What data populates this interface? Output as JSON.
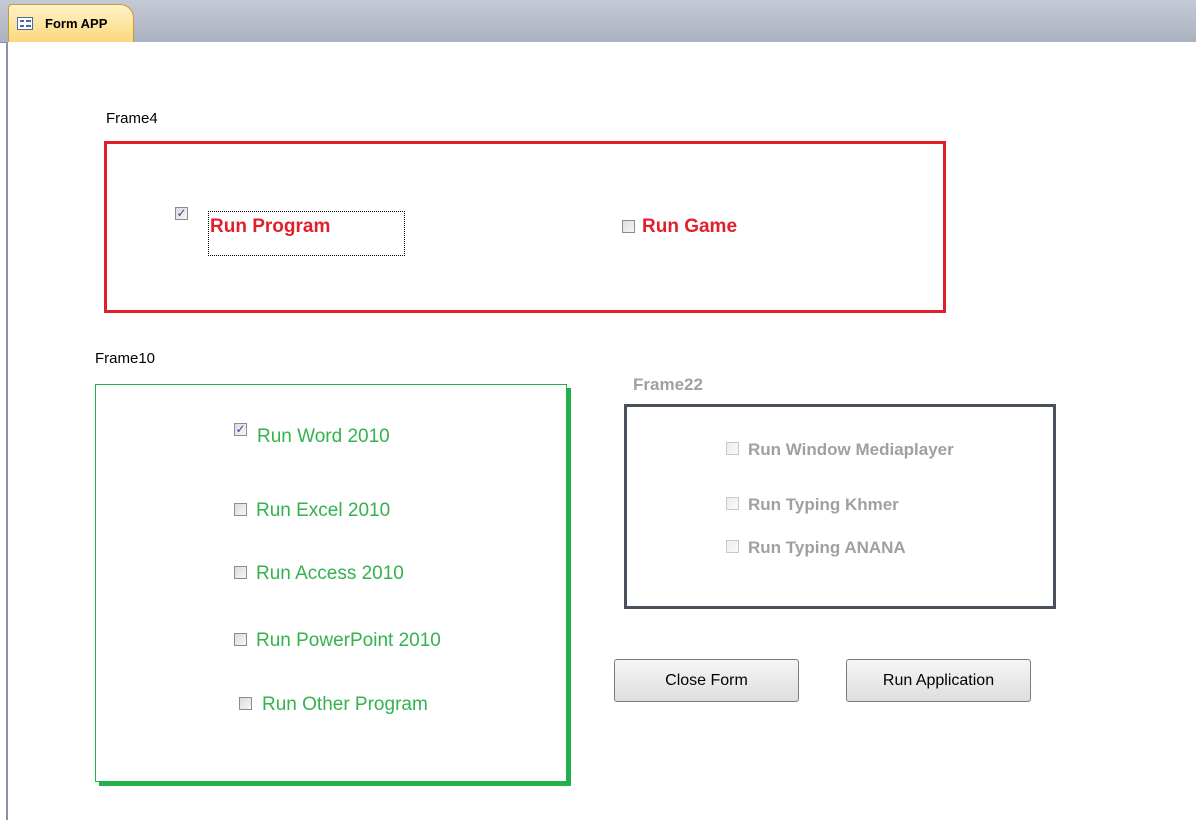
{
  "tab": {
    "title": "Form APP",
    "icon": "form-icon"
  },
  "frames": {
    "frame4": {
      "label": "Frame4",
      "options": [
        {
          "label": "Run Program",
          "checked": true
        },
        {
          "label": "Run Game",
          "checked": false
        }
      ]
    },
    "frame10": {
      "label": "Frame10",
      "options": [
        {
          "label": "Run Word 2010",
          "checked": true
        },
        {
          "label": "Run Excel 2010",
          "checked": false
        },
        {
          "label": "Run Access 2010",
          "checked": false
        },
        {
          "label": "Run PowerPoint 2010",
          "checked": false
        },
        {
          "label": "Run Other Program",
          "checked": false
        }
      ]
    },
    "frame22": {
      "label": "Frame22",
      "disabled": true,
      "options": [
        {
          "label": "Run  Window Mediaplayer",
          "checked": false
        },
        {
          "label": "Run Typing Khmer",
          "checked": false
        },
        {
          "label": "Run Typing ANANA",
          "checked": false
        }
      ]
    }
  },
  "buttons": {
    "close": "Close Form",
    "run": "Run Application"
  },
  "colors": {
    "frame4": "#e0202a",
    "frame10": "#22b04a",
    "frame22": "#4a505c",
    "disabled_text": "#a0a0a0"
  }
}
